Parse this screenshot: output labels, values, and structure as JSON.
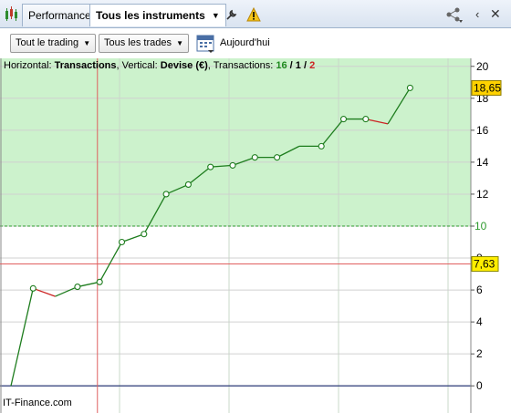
{
  "tabs": {
    "performance_label": "Performance",
    "instruments_label": "Tous les instruments"
  },
  "toolbar": {
    "trading_filter": "Tout le trading",
    "trades_filter": "Tous les trades",
    "today_label": "Aujourd'hui"
  },
  "info": {
    "prefix": "Horizontal: ",
    "h_axis": "Transactions",
    "mid": ", Vertical: ",
    "v_axis": "Devise (€)",
    "mid2": ", Transactions: ",
    "count_win": "16",
    "sep1": " / ",
    "count_neutral": "1",
    "sep2": " / ",
    "count_loss": "2"
  },
  "footer": {
    "credit": "IT-Finance.com"
  },
  "colors": {
    "profit_zone": "#ccf2cc",
    "win_line": "#1e7d1e",
    "loss_line": "#cc2222",
    "crosshair": "#e06060",
    "zero_line": "#1a2a6e",
    "badge": "#ffee00"
  },
  "chart_data": {
    "type": "line",
    "x": [
      0,
      1,
      2,
      3,
      4,
      5,
      6,
      7,
      8,
      9,
      10,
      11,
      12,
      13,
      14,
      15,
      16,
      17,
      18,
      19
    ],
    "y": [
      0,
      6.1,
      5.6,
      6.2,
      6.5,
      9.0,
      9.5,
      12.0,
      12.6,
      13.7,
      13.8,
      14.3,
      14.3,
      15.0,
      15.0,
      16.7,
      16.7,
      16.4,
      18.65
    ],
    "loss_segments": [
      [
        1,
        2
      ],
      [
        16,
        17
      ]
    ],
    "ylim": [
      -1.7,
      20.5
    ],
    "yticks": [
      "20",
      "18",
      "16",
      "14",
      "12",
      "10",
      "8",
      "6",
      "4",
      "2",
      "0"
    ],
    "ytick_values": [
      20,
      18,
      16,
      14,
      12,
      10,
      8,
      6,
      4,
      2,
      0
    ],
    "last_value_label": "18,65",
    "crosshair_value_label": "7,63",
    "crosshair_value": 7.63,
    "crosshair_x": 3.9,
    "zone_threshold": 10,
    "zone_label": "10"
  }
}
